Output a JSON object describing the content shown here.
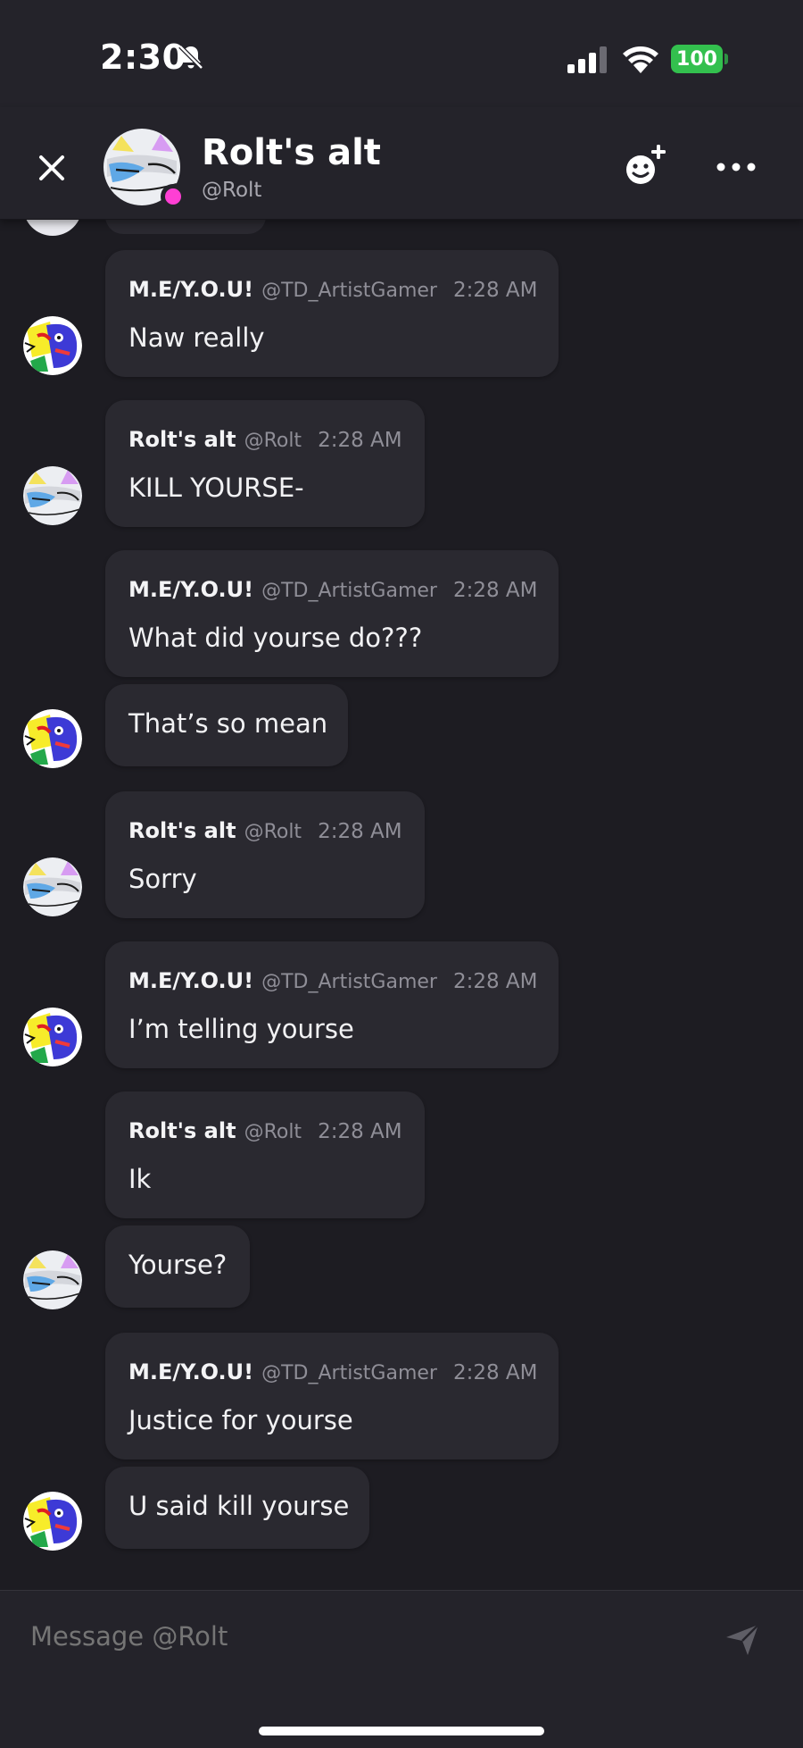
{
  "status_bar": {
    "time": "2:30",
    "battery": "100",
    "icons": [
      "bell-muted-icon",
      "signal-icon",
      "wifi-icon",
      "battery-icon"
    ],
    "battery_color": "#33c04e"
  },
  "header": {
    "title": "Rolt's alt",
    "handle": "@Rolt",
    "presence_color": "#ff3fd4",
    "icons": [
      "close-icon",
      "add-friend-icon",
      "more-icon"
    ]
  },
  "messages": [
    {
      "author": "M.E/Y.O.U!",
      "handle": "@TD_ArtistGamer",
      "time": "2:28 AM",
      "text": "Naw really",
      "avatar": "meyou"
    },
    {
      "author": "Rolt's alt",
      "handle": "@Rolt",
      "time": "2:28 AM",
      "text": "KILL YOURSE-",
      "avatar": "rolt"
    },
    {
      "author": "M.E/Y.O.U!",
      "handle": "@TD_ArtistGamer",
      "time": "2:28 AM",
      "text": "What did yourse do???",
      "avatar": "meyou"
    },
    {
      "text": "That’s so mean",
      "avatar": "meyou"
    },
    {
      "author": "Rolt's alt",
      "handle": "@Rolt",
      "time": "2:28 AM",
      "text": "Sorry",
      "avatar": "rolt"
    },
    {
      "author": "M.E/Y.O.U!",
      "handle": "@TD_ArtistGamer",
      "time": "2:28 AM",
      "text": "I’m telling yourse",
      "avatar": "meyou"
    },
    {
      "author": "Rolt's alt",
      "handle": "@Rolt",
      "time": "2:28 AM",
      "text": "Ik",
      "avatar": "rolt"
    },
    {
      "text": "Yourse?",
      "avatar": "rolt"
    },
    {
      "author": "M.E/Y.O.U!",
      "handle": "@TD_ArtistGamer",
      "time": "2:28 AM",
      "text": "Justice for yourse",
      "avatar": "meyou"
    },
    {
      "text": "U said kill yourse",
      "avatar": "meyou"
    }
  ],
  "composer": {
    "placeholder": "Message @Rolt",
    "send_icon": "send-icon"
  },
  "colors": {
    "background": "#1d1c22",
    "bar": "#24232a",
    "bubble": "#2a2930"
  }
}
